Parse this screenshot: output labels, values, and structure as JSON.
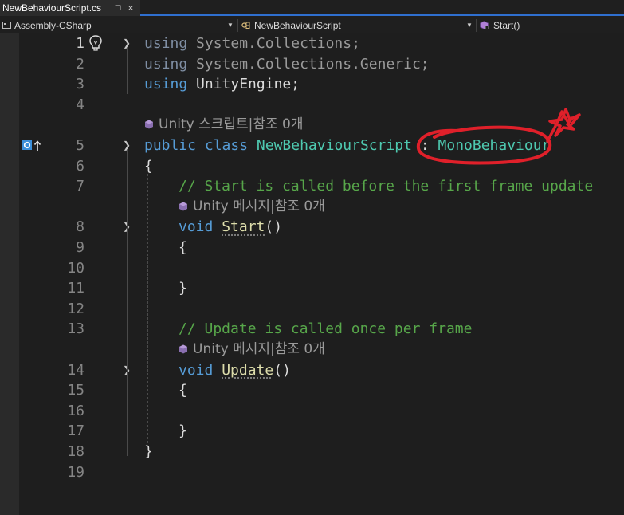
{
  "tab": {
    "title": "NewBehaviourScript.cs",
    "pin": "⊐",
    "close": "×"
  },
  "nav": {
    "project": "Assembly-CSharp",
    "class": "NewBehaviourScript",
    "member": "Start()"
  },
  "lines": [
    {
      "n": "1"
    },
    {
      "n": "2"
    },
    {
      "n": "3"
    },
    {
      "n": "4"
    },
    {
      "n": "5"
    },
    {
      "n": "6"
    },
    {
      "n": "7"
    },
    {
      "n": "8"
    },
    {
      "n": "9"
    },
    {
      "n": "10"
    },
    {
      "n": "11"
    },
    {
      "n": "12"
    },
    {
      "n": "13"
    },
    {
      "n": "14"
    },
    {
      "n": "15"
    },
    {
      "n": "16"
    },
    {
      "n": "17"
    },
    {
      "n": "18"
    },
    {
      "n": "19"
    }
  ],
  "code": {
    "using": "using",
    "ns1": "System.Collections;",
    "ns2": "System.Collections.Generic;",
    "ns3": "UnityEngine;",
    "lens_class": "Unity 스크립트|참조 0개",
    "public": "public",
    "class_kw": "class",
    "class_name": "NewBehaviourScript",
    "colon": ":",
    "base": "MonoBehaviour",
    "open_brace": "{",
    "close_brace": "}",
    "comment_start": "// Start is called before the first frame update",
    "lens_msg": "Unity 메시지|참조 0개",
    "void": "void",
    "start": "Start",
    "parens": "()",
    "comment_update": "// Update is called once per frame",
    "update": "Update"
  },
  "colors": {
    "keyword": "#569cd6",
    "type": "#4ec9b0",
    "comment": "#57a64a",
    "annotation": "#e0202a"
  }
}
